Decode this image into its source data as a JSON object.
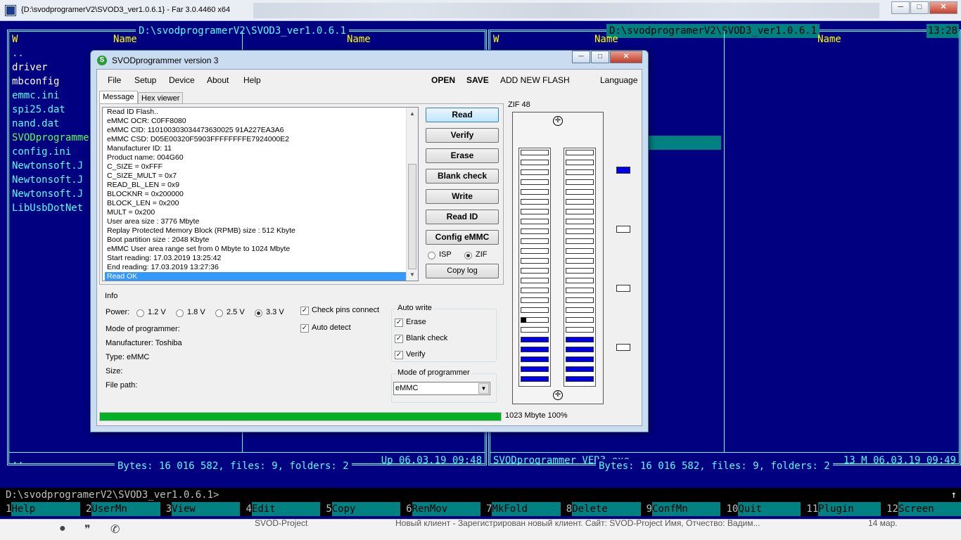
{
  "titlebar": {
    "title": "{D:\\svodprogramerV2\\SVOD3_ver1.0.6.1} - Far 3.0.4460 x64",
    "minimize": "─",
    "maximize": "□",
    "close": "✕"
  },
  "far": {
    "left_title": " D:\\svodprogramerV2\\SVOD3_ver1.0.6.1 ",
    "right_title": " D:\\svodprogramerV2\\SVOD3_ver1.0.6.1 ",
    "clock": "13:28",
    "col_w": "W",
    "col_name": "Name",
    "left_files": [
      {
        "name": "..",
        "color": "#55ffff"
      },
      {
        "name": "driver",
        "color": "#ffffff"
      },
      {
        "name": "mbconfig",
        "color": "#ffffff"
      },
      {
        "name": "emmc.ini",
        "color": "#55ffff"
      },
      {
        "name": "spi25.dat",
        "color": "#55ffff"
      },
      {
        "name": "nand.dat",
        "color": "#55ffff"
      },
      {
        "name": "SVODprogrammer",
        "color": "#55ff55"
      },
      {
        "name": "config.ini",
        "color": "#55ffff"
      },
      {
        "name": "Newtonsoft.J",
        "color": "#55ffff"
      },
      {
        "name": "Newtonsoft.J",
        "color": "#55ffff"
      },
      {
        "name": "Newtonsoft.J",
        "color": "#55ffff"
      },
      {
        "name": "LibUsbDotNet",
        "color": "#55ffff"
      }
    ],
    "left_info_name": "..",
    "left_info_right": "Up    06.03.19 09:48",
    "right_info_name": "SVODprogrammer VER3.exe",
    "right_info_right": "13 M 06.03.19 09:49",
    "left_bytes": " Bytes: 16 016 582, files: 9, folders: 2 ",
    "right_bytes": " Bytes: 16 016 582, files: 9, folders: 2 ",
    "cmdline": "D:\\svodprogramerV2\\SVOD3_ver1.0.6.1>",
    "scroll_arrow": "↑",
    "keybar": [
      {
        "n": "1",
        "l": "Help"
      },
      {
        "n": "2",
        "l": "UserMn"
      },
      {
        "n": "3",
        "l": "View"
      },
      {
        "n": "4",
        "l": "Edit"
      },
      {
        "n": "5",
        "l": "Copy"
      },
      {
        "n": "6",
        "l": "RenMov"
      },
      {
        "n": "7",
        "l": "MkFold"
      },
      {
        "n": "8",
        "l": "Delete"
      },
      {
        "n": "9",
        "l": "ConfMn"
      },
      {
        "n": "10",
        "l": "Quit"
      },
      {
        "n": "11",
        "l": "Plugin"
      },
      {
        "n": "12",
        "l": "Screen"
      }
    ]
  },
  "dialog": {
    "title": "SVODprogrammer version 3",
    "icon_glyph": "S",
    "minimize": "─",
    "maximize": "□",
    "close": "✕",
    "menu": [
      "File",
      "Setup",
      "Device",
      "About",
      "Help"
    ],
    "open": "OPEN",
    "save": "SAVE",
    "add_flash": "ADD NEW FLASH",
    "language": "Language",
    "tabs": [
      "Message",
      "Hex viewer"
    ],
    "log": [
      "Read ID Flash..",
      "eMMC OCR: C0FF8080",
      "eMMC CID: 110100303034473630025 91A227EA3A6",
      "eMMC CSD: D05E00320F5903FFFFFFFFE7924000E2",
      "Manufacturer ID: 11",
      "Product name: 004G60",
      "C_SIZE = 0xFFF",
      "C_SIZE_MULT = 0x7",
      "READ_BL_LEN = 0x9",
      "BLOCKNR = 0x200000",
      "BLOCK_LEN = 0x200",
      "MULT = 0x200",
      "User area size : 3776 Mbyte",
      "Replay Protected Memory Block (RPMB) size : 512 Kbyte",
      "Boot partition size : 2048 Kbyte",
      "eMMC User area range set from 0 Mbyte to 1024 Mbyte",
      "Start reading: 17.03.2019 13:25:42",
      "End reading: 17.03.2019 13:27:36",
      "Read OK"
    ],
    "buttons": [
      "Read",
      "Verify",
      "Erase",
      "Blank check",
      "Write",
      "Read ID",
      "Config eMMC"
    ],
    "isp": "ISP",
    "zif": "ZIF",
    "copy_log": "Copy log",
    "info_group": "Info",
    "power_label": "Power:",
    "power_options": [
      "1.2 V",
      "1.8 V",
      "2.5 V",
      "3.3 V"
    ],
    "power_selected": "3.3 V",
    "check_pins": "Check pins connect",
    "auto_detect": "Auto detect",
    "mode_label": "Mode of programmer:",
    "manufacturer": "Manufacturer: Toshiba",
    "type": "Type: eMMC",
    "size": "Size:",
    "file_path": "File path:",
    "auto_write_group": "Auto write",
    "aw_erase": "Erase",
    "aw_blank": "Blank check",
    "aw_verify": "Verify",
    "mode_group": "Mode of programmer",
    "mode_value": "eMMC",
    "zif_label": "ZIF 48",
    "progress": 1.0,
    "progress_text": "1023 Mbyte 100%"
  },
  "bottom": {
    "title": "SVOD-Project",
    "msg": "Новый клиент - Зарегистрирован новый клиент. Сайт: SVOD-Project Имя, Отчество: Вадим...",
    "date": "14 мар."
  }
}
